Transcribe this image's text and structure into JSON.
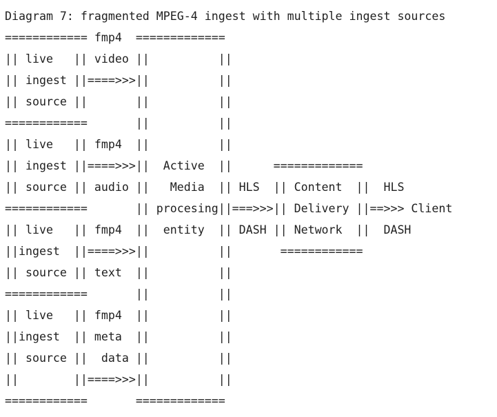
{
  "diagram": {
    "title": "Diagram 7: fragmented MPEG-4 ingest with multiple ingest sources",
    "lines": [
      "============ fmp4  =============",
      "|| live   || video ||          ||",
      "|| ingest ||====>>>||          ||",
      "|| source ||       ||          ||",
      "============       ||          ||",
      "|| live   || fmp4  ||          ||",
      "|| ingest ||====>>>||  Active  ||      =============",
      "|| source || audio ||   Media  || HLS  || Content  ||  HLS",
      "============       || procesing||===>>>|| Delivery ||==>>> Client",
      "|| live   || fmp4  ||  entity  || DASH || Network  ||  DASH",
      "||ingest  ||====>>>||          ||       ============",
      "|| source || text  ||          ||",
      "============       ||          ||",
      "|| live   || fmp4  ||          ||",
      "||ingest  || meta  ||          ||",
      "|| source ||  data ||          ||",
      "||        ||====>>>||          ||",
      "============       ============="
    ]
  }
}
